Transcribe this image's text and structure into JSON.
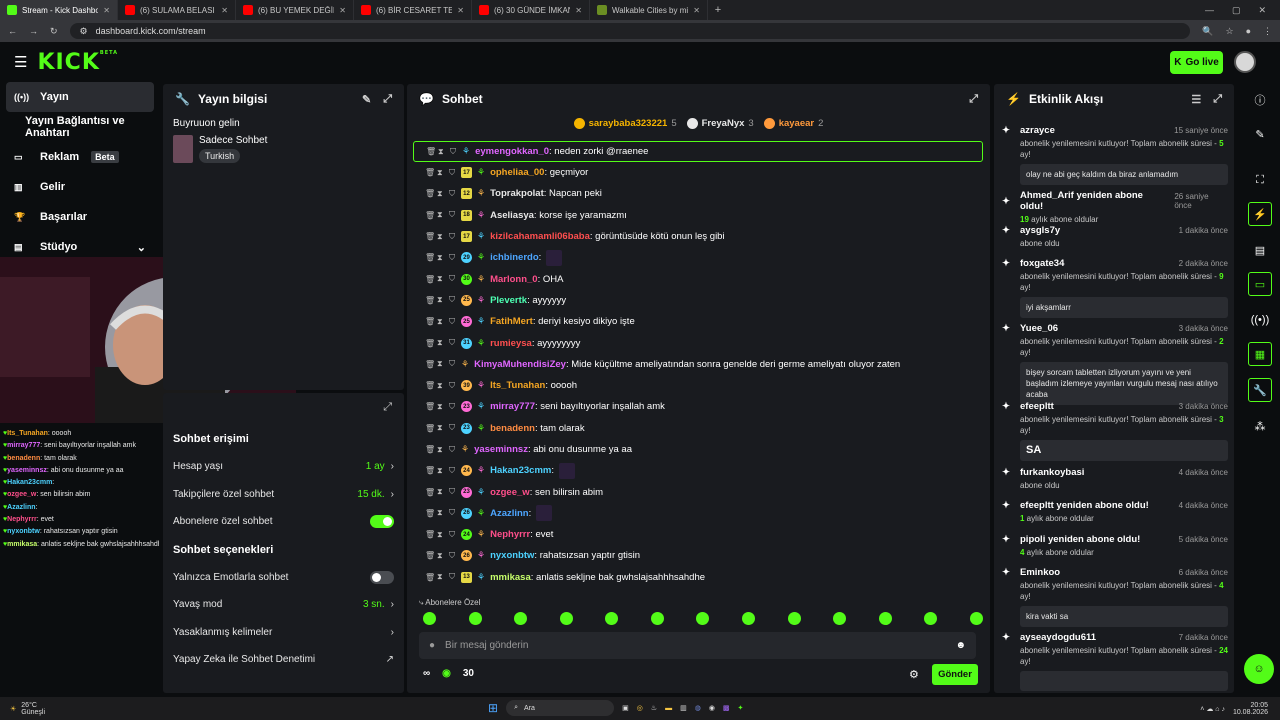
{
  "browser": {
    "tabs": [
      {
        "title": "Stream - Kick Dashboard",
        "color": "#53fc18"
      },
      {
        "title": "(6) SULAMA BELASI | 5Sriders |",
        "color": "#ff0000"
      },
      {
        "title": "(6) BU YEMEK DEĞİL ADETA ŞÖ",
        "color": "#ff0000"
      },
      {
        "title": "(6) BİR CESARET TESTİ NASIL Fİ",
        "color": "#ff0000"
      },
      {
        "title": "(6) 30 GÜNDE İMKANSIZI BAŞA",
        "color": "#ff0000"
      },
      {
        "title": "Walkable Cities by mizizisiz",
        "color": "#6b8e23"
      }
    ],
    "new_tab": "+",
    "url": "dashboard.kick.com/stream"
  },
  "header": {
    "logo": "KICK",
    "logo_sup": "BETA",
    "golive_label": "Go live"
  },
  "leftnav": {
    "items": [
      {
        "label": "Yayın",
        "icon": "radio-icon"
      },
      {
        "label": "Yayın Bağlantısı ve Anahtarı",
        "icon": ""
      },
      {
        "label": "Reklam",
        "icon": "ad-icon",
        "badge": "Beta"
      },
      {
        "label": "Gelir",
        "icon": "chart-icon"
      },
      {
        "label": "Başarılar",
        "icon": "trophy-icon"
      },
      {
        "label": "Stüdyo",
        "icon": "studio-icon"
      }
    ]
  },
  "minichat": [
    {
      "user": "Its_Tunahan",
      "msg": "ooooh",
      "color": "#f5a623"
    },
    {
      "user": "mirray777",
      "msg": "seni bayıltıyorlar inşallah amk",
      "color": "#e066ff"
    },
    {
      "user": "benadenn",
      "msg": "tam olarak",
      "color": "#ff8c42"
    },
    {
      "user": "yaseminnsz",
      "msg": "abi onu dusunme ya aa",
      "color": "#e066ff"
    },
    {
      "user": "Hakan23cmm",
      "msg": "",
      "color": "#4dd2ff"
    },
    {
      "user": "ozgee_w",
      "msg": "sen bilirsin abim",
      "color": "#ff4f8b"
    },
    {
      "user": "Azazlinn",
      "msg": "",
      "color": "#4dd2ff"
    },
    {
      "user": "Nephyrrr",
      "msg": "evet",
      "color": "#ff4f8b"
    },
    {
      "user": "nyxonbtw",
      "msg": "rahatsızsan yaptır gtisin",
      "color": "#4dd2ff"
    },
    {
      "user": "mmikasa",
      "msg": "anlatis sekljne bak gwhslajsahhhsahdhe",
      "color": "#c7ff6b"
    }
  ],
  "info": {
    "title": "Yayın bilgisi",
    "greeting": "Buyruuon gelin",
    "category": "Sadece Sohbet",
    "tag": "Turkish"
  },
  "chat_settings": {
    "access_title": "Sohbet erişimi",
    "rows_access": [
      {
        "label": "Hesap yaşı",
        "value": "1 ay"
      },
      {
        "label": "Takipçilere özel sohbet",
        "value": "15 dk."
      },
      {
        "label": "Abonelere özel sohbet",
        "value": ""
      }
    ],
    "options_title": "Sohbet seçenekleri",
    "rows_options": [
      {
        "label": "Yalnızca Emotlarla sohbet",
        "value": ""
      },
      {
        "label": "Yavaş mod",
        "value": "3 sn."
      },
      {
        "label": "Yasaklanmış kelimeler",
        "value": ""
      },
      {
        "label": "Yapay Zeka ile Sohbet Denetimi",
        "value": ""
      }
    ]
  },
  "chat": {
    "title": "Sohbet",
    "top_gifters": [
      {
        "name": "saraybaba323221",
        "count": "5",
        "color": "#f5b400"
      },
      {
        "name": "FreyaNyx",
        "count": "3",
        "color": "#e8e8e8"
      },
      {
        "name": "kayaear",
        "count": "2",
        "color": "#ff9a3c"
      }
    ],
    "messages": [
      {
        "user": "eymengokkan_0",
        "msg": "neden zorki @rraenee",
        "color": "#e066ff",
        "month": "",
        "highlight": true
      },
      {
        "user": "opheliaa_00",
        "msg": "geçmiyor",
        "color": "#f5a623",
        "month": "17"
      },
      {
        "user": "Toprakpolat",
        "msg": "Napcan peki",
        "color": "#e8e8e8",
        "month": "12"
      },
      {
        "user": "Aseliasya",
        "msg": "korse işe yaramazmı",
        "color": "#e8e8e8",
        "month": "18"
      },
      {
        "user": "kizilcahamamli06baba",
        "msg": "görüntüsüde kötü onun leş gibi",
        "color": "#ff4f4f",
        "month": "17"
      },
      {
        "user": "ichbinerdo",
        "msg": "",
        "color": "#4da6ff",
        "month": "29"
      },
      {
        "user": "Marlonn_0",
        "msg": "OHA",
        "color": "#ff4f8b",
        "month": "30"
      },
      {
        "user": "Plevertk",
        "msg": "ayyyyyy",
        "color": "#4dffb3",
        "month": "25"
      },
      {
        "user": "FatihMert",
        "msg": "deriyi kesiyo dikiyo işte",
        "color": "#f5a623",
        "month": "25"
      },
      {
        "user": "rumieysa",
        "msg": "ayyyyyyyy",
        "color": "#ff4f4f",
        "month": "31"
      },
      {
        "user": "KimyaMuhendisiZey",
        "msg": "Mide küçültme ameliyatından sonra genelde deri germe ameliyatı oluyor zaten",
        "color": "#e066ff",
        "month": ""
      },
      {
        "user": "Its_Tunahan",
        "msg": "ooooh",
        "color": "#f5a623",
        "month": "39"
      },
      {
        "user": "mirray777",
        "msg": "seni bayıltıyorlar inşallah amk",
        "color": "#e066ff",
        "month": "23"
      },
      {
        "user": "benadenn",
        "msg": "tam olarak",
        "color": "#ff8c42",
        "month": "23"
      },
      {
        "user": "yaseminnsz",
        "msg": "abi onu dusunme ya aa",
        "color": "#e066ff",
        "month": ""
      },
      {
        "user": "Hakan23cmm",
        "msg": "",
        "color": "#4dd2ff",
        "month": "24"
      },
      {
        "user": "ozgee_w",
        "msg": "sen bilirsin abim",
        "color": "#ff4f8b",
        "month": "23"
      },
      {
        "user": "Azazlinn",
        "msg": "",
        "color": "#4da6ff",
        "month": "26"
      },
      {
        "user": "Nephyrrr",
        "msg": "evet",
        "color": "#ff4f8b",
        "month": "24"
      },
      {
        "user": "nyxonbtw",
        "msg": "rahatsızsan yaptır gtisin",
        "color": "#4dd2ff",
        "month": "26"
      },
      {
        "user": "mmikasa",
        "msg": "anlatis sekljne bak gwhslajsahhhsahdhe",
        "color": "#c7ff6b",
        "month": "13"
      }
    ],
    "emote_section": "Abonelere Özel",
    "input_placeholder": "Bir mesaj gönderin",
    "points": "30",
    "send_label": "Gönder"
  },
  "activity": {
    "title": "Etkinlik Akışı",
    "items": [
      {
        "title": "azrayce",
        "time": "15 saniye önce",
        "sub": "abonelik yenilemesini kutluyor! Toplam abonelik süresi - ",
        "months": "5",
        "suffix": " ay!",
        "msg": "olay ne abi geç kaldım da biraz anlamadım"
      },
      {
        "title": "Ahmed_Arif yeniden abone oldu!",
        "time": "26 saniye önce",
        "sub": "",
        "months": "19",
        "suffix": " aylık abone oldular",
        "msg": ""
      },
      {
        "title": "aysgls7y",
        "time": "1 dakika önce",
        "sub": "abone oldu",
        "months": "",
        "suffix": "",
        "msg": ""
      },
      {
        "title": "foxgate34",
        "time": "2 dakika önce",
        "sub": "abonelik yenilemesini kutluyor! Toplam abonelik süresi - ",
        "months": "9",
        "suffix": " ay!",
        "msg": "iyi akşamlarr"
      },
      {
        "title": "Yuee_06",
        "time": "3 dakika önce",
        "sub": "abonelik yenilemesini kutluyor! Toplam abonelik süresi - ",
        "months": "2",
        "suffix": " ay!",
        "msg": "bişey sorcam tabletten izliyorum yayını ve yeni başladım izlemeye yayınları vurgulu mesaj nası atılıyo acaba"
      },
      {
        "title": "efeepltt",
        "time": "3 dakika önce",
        "sub": "abonelik yenilemesini kutluyor! Toplam abonelik süresi - ",
        "months": "3",
        "suffix": " ay!",
        "msg": "SA"
      },
      {
        "title": "furkankoybasi",
        "time": "4 dakika önce",
        "sub": "abone oldu",
        "months": "",
        "suffix": "",
        "msg": ""
      },
      {
        "title": "efeepltt yeniden abone oldu!",
        "time": "4 dakika önce",
        "sub": "",
        "months": "1",
        "suffix": " aylık abone oldular",
        "msg": ""
      },
      {
        "title": "pipoli yeniden abone oldu!",
        "time": "5 dakika önce",
        "sub": "",
        "months": "4",
        "suffix": " aylık abone oldular",
        "msg": ""
      },
      {
        "title": "Eminkoo",
        "time": "6 dakika önce",
        "sub": "abonelik yenilemesini kutluyor! Toplam abonelik süresi - ",
        "months": "4",
        "suffix": " ay!",
        "msg": "kira vakti sa"
      },
      {
        "title": "ayseaydogdu611",
        "time": "7 dakika önce",
        "sub": "abonelik yenilemesini kutluyor! Toplam abonelik süresi - ",
        "months": "24",
        "suffix": " ay!",
        "msg": ""
      }
    ]
  },
  "taskbar": {
    "weather_temp": "26°C",
    "weather_desc": "Güneşli",
    "search": "Ara",
    "time": "20:05",
    "date": "10.08.2026"
  },
  "colors": {
    "accent": "#53fc18",
    "panel": "#191b1f",
    "bg": "#0b0d0f"
  }
}
